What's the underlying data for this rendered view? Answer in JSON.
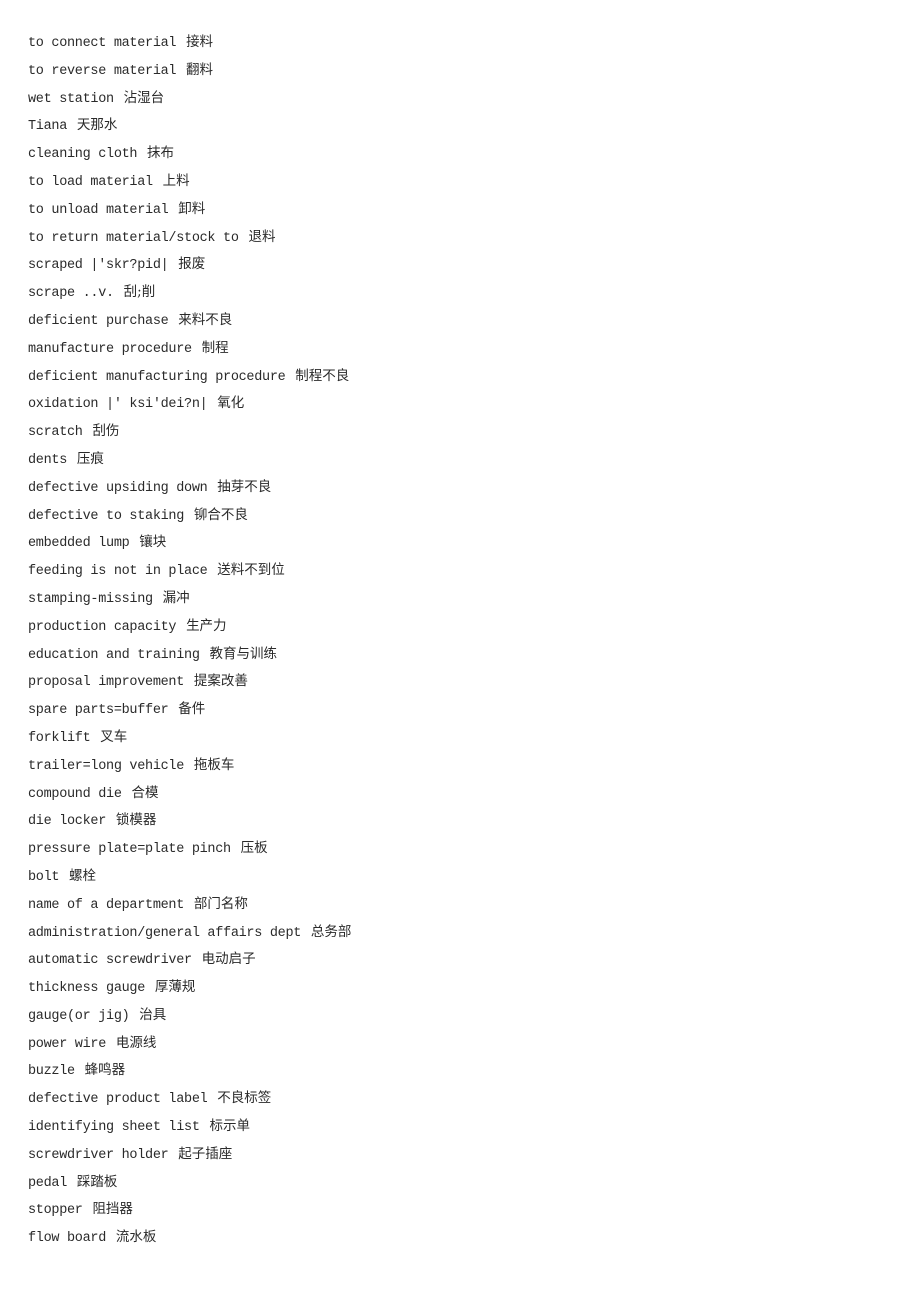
{
  "glossary": [
    {
      "en": "to connect material",
      "zh": "接料"
    },
    {
      "en": "to reverse material ",
      "zh": "翻料"
    },
    {
      "en": "wet station",
      "zh": "沾湿台"
    },
    {
      "en": "Tiana",
      "zh": "天那水"
    },
    {
      "en": "cleaning cloth",
      "zh": "抹布"
    },
    {
      "en": "to load material",
      "zh": "上料"
    },
    {
      "en": "to unload material",
      "zh": "卸料"
    },
    {
      "en": "to return material/stock to",
      "zh": "退料"
    },
    {
      "en": "scraped |'skr?pid|",
      "zh": "报废"
    },
    {
      "en": "scrape ..v.",
      "zh": "刮;削"
    },
    {
      "en": "deficient purchase",
      "zh": "来料不良"
    },
    {
      "en": "manufacture procedure",
      "zh": "制程"
    },
    {
      "en": "deficient manufacturing procedure",
      "zh": "制程不良"
    },
    {
      "en": "oxidation |' ksi'dei?n|",
      "zh": "氧化"
    },
    {
      "en": "scratch",
      "zh": "刮伤"
    },
    {
      "en": "dents",
      "zh": "压痕"
    },
    {
      "en": "defective upsiding down",
      "zh": "抽芽不良"
    },
    {
      "en": "defective to staking",
      "zh": "铆合不良"
    },
    {
      "en": "embedded lump",
      "zh": "镶块"
    },
    {
      "en": "feeding is not in place",
      "zh": "送料不到位"
    },
    {
      "en": "stamping-missing",
      "zh": "漏冲"
    },
    {
      "en": "production capacity",
      "zh": "生产力"
    },
    {
      "en": "education and training",
      "zh": "教育与训练"
    },
    {
      "en": "proposal improvement",
      "zh": "提案改善"
    },
    {
      "en": "spare parts=buffer",
      "zh": "备件"
    },
    {
      "en": "forklift",
      "zh": "叉车"
    },
    {
      "en": "trailer=long vehicle",
      "zh": "拖板车"
    },
    {
      "en": "compound die",
      "zh": "合模"
    },
    {
      "en": "die locker",
      "zh": "锁模器"
    },
    {
      "en": "pressure plate=plate pinch",
      "zh": "压板"
    },
    {
      "en": "bolt",
      "zh": "螺栓"
    },
    {
      "en": "name of a department",
      "zh": "部门名称"
    },
    {
      "en": "administration/general affairs dept",
      "zh": "总务部"
    },
    {
      "en": "automatic screwdriver",
      "zh": "电动启子"
    },
    {
      "en": "thickness gauge",
      "zh": "厚薄规"
    },
    {
      "en": "gauge(or jig)",
      "zh": "治具"
    },
    {
      "en": "power wire",
      "zh": "电源线"
    },
    {
      "en": "buzzle",
      "zh": "蜂鸣器"
    },
    {
      "en": "defective product label",
      "zh": "不良标签"
    },
    {
      "en": "identifying sheet list",
      "zh": "标示单"
    },
    {
      "en": "screwdriver holder",
      "zh": "起子插座"
    },
    {
      "en": "pedal",
      "zh": "踩踏板"
    },
    {
      "en": "stopper",
      "zh": "阻挡器"
    },
    {
      "en": "flow board",
      "zh": "流水板"
    }
  ]
}
